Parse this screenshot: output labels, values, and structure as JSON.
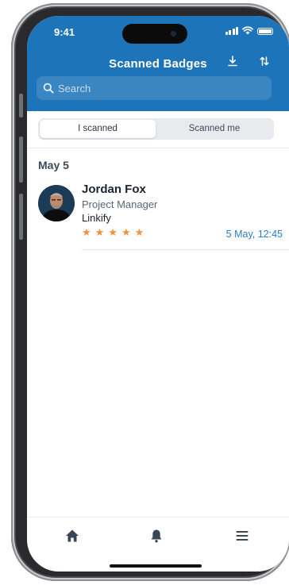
{
  "status_bar": {
    "time": "9:41"
  },
  "header": {
    "title": "Scanned Badges",
    "download_icon": "download-icon",
    "sort_icon": "sort-arrows-icon",
    "background": "#1e74b8"
  },
  "search": {
    "placeholder": "Search",
    "icon": "search-icon"
  },
  "tabs": [
    {
      "label": "I scanned",
      "active": true
    },
    {
      "label": "Scanned me",
      "active": false
    }
  ],
  "groups": [
    {
      "date": "May 5",
      "contacts": [
        {
          "name": "Jordan Fox",
          "title": "Project Manager",
          "company": "Linkify",
          "rating": 5,
          "timestamp": "5 May, 12:45"
        }
      ]
    }
  ],
  "bottom_nav": [
    {
      "icon": "home-icon"
    },
    {
      "icon": "bell-icon"
    },
    {
      "icon": "menu-icon"
    }
  ],
  "colors": {
    "accent": "#1e74b8",
    "star": "#f2913b",
    "timestamp": "#2b7fc0"
  }
}
